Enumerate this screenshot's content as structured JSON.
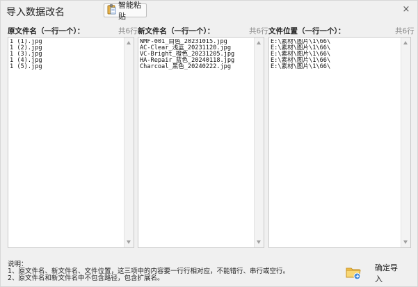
{
  "window": {
    "title": "导入数据改名",
    "paste_button_label": "智能粘贴",
    "close_label": "×"
  },
  "panels": [
    {
      "header": "原文件名（一行一个）：",
      "count": "共6行",
      "lines": [
        "1 (1).jpg",
        "1 (2).jpg",
        "1 (3).jpg",
        "1 (4).jpg",
        "1 (5).jpg"
      ]
    },
    {
      "header": "新文件名（一行一个）：",
      "count": "共6行",
      "lines": [
        "NMF-001_白色_20231015.jpg",
        "AC-Clear_浅蓝_20231120.jpg",
        "VC-Bright_橙色_20231205.jpg",
        "HA-Repair_蓝色_20240118.jpg",
        "Charcoal_黑色_20240222.jpg"
      ]
    },
    {
      "header": "文件位置（一行一个）：",
      "count": "共6行",
      "lines": [
        "E:\\素材\\图片\\1\\66\\",
        "E:\\素材\\图片\\1\\66\\",
        "E:\\素材\\图片\\1\\66\\",
        "E:\\素材\\图片\\1\\66\\",
        "E:\\素材\\图片\\1\\66\\"
      ]
    }
  ],
  "notes": {
    "title": "说明：",
    "line1": "1、原文件名、新文件名、文件位置，这三项中的内容要一行行相对应，不能错行、串行或空行。",
    "line2": "2、原文件名和新文件名中不包含路径，包含扩展名。"
  },
  "import_button_label": "确定导入",
  "icons": {
    "paste": "clipboard-icon",
    "import": "folder-import-icon",
    "close": "close-icon"
  }
}
